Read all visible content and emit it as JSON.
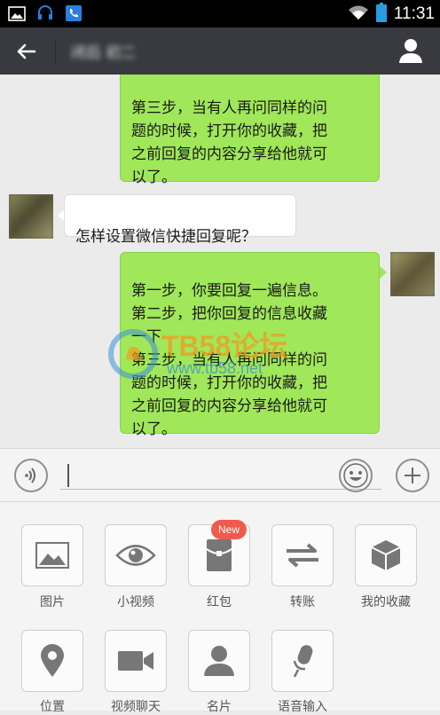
{
  "status_bar": {
    "time": "11:31"
  },
  "header": {
    "contact_name": "闭后 初二"
  },
  "messages": [
    {
      "from": "me",
      "text": "第三步，当有人再问同样的问\n题的时候，打开你的收藏，把\n之前回复的内容分享给他就可\n以了。"
    },
    {
      "from": "other",
      "text": "怎样设置微信快捷回复呢？"
    },
    {
      "from": "me",
      "text": "第一步，你要回复一遍信息。\n第二步，把你回复的信息收藏\n一下\n第三步，当有人再问同样的问\n题的时候，打开你的收藏，把\n之前回复的内容分享给他就可\n以了。"
    }
  ],
  "watermark": {
    "brand": "TB58论坛",
    "url": "www.tb58.net"
  },
  "input_bar": {
    "value": ""
  },
  "panel": {
    "items": [
      {
        "label": "图片",
        "icon": "picture-icon"
      },
      {
        "label": "小视频",
        "icon": "eye-icon"
      },
      {
        "label": "红包",
        "icon": "red-packet-icon",
        "badge": "New"
      },
      {
        "label": "转账",
        "icon": "transfer-icon"
      },
      {
        "label": "我的收藏",
        "icon": "cube-icon"
      },
      {
        "label": "位置",
        "icon": "location-pin-icon"
      },
      {
        "label": "视频聊天",
        "icon": "video-camera-icon"
      },
      {
        "label": "名片",
        "icon": "person-card-icon"
      },
      {
        "label": "语音输入",
        "icon": "microphone-icon"
      }
    ]
  },
  "colors": {
    "titlebar": "#393a3f",
    "bubble_me": "#a0e75a",
    "badge": "#f05a4d"
  }
}
